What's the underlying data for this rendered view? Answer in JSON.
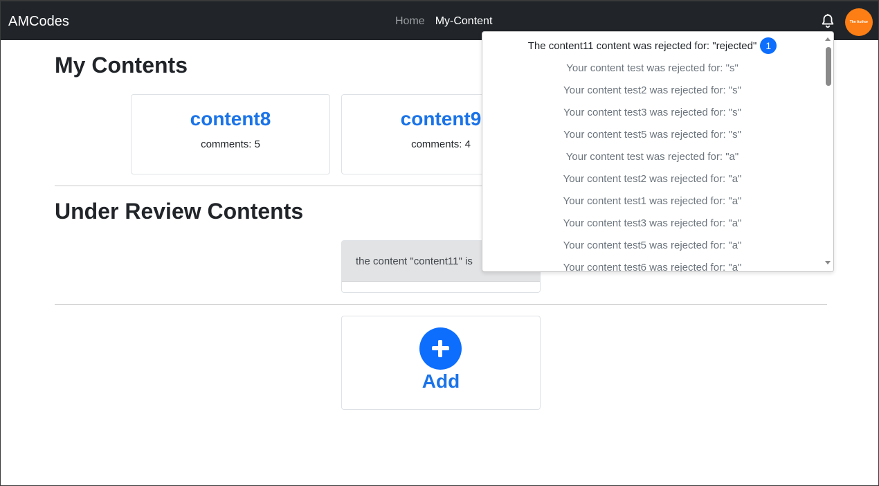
{
  "navbar": {
    "brand": "AMCodes",
    "links": [
      {
        "label": "Home"
      },
      {
        "label": "My-Content"
      }
    ],
    "avatar_text": "The Author",
    "icons": {
      "notifications": "bell-icon"
    }
  },
  "my_contents": {
    "title": "My Contents",
    "cards": [
      {
        "title": "content8",
        "comments": "comments: 5"
      },
      {
        "title": "content9",
        "comments": "comments: 4"
      }
    ]
  },
  "under_review": {
    "title": "Under Review Contents",
    "alert_text": "the content \"content11\" is"
  },
  "add_card": {
    "label": "Add",
    "icon": "plus-circle-icon"
  },
  "notifications": {
    "items": [
      {
        "text": "The content11 content was rejected for: \"rejected\"",
        "badge": "1"
      },
      {
        "text": "Your content test was rejected for: \"s\""
      },
      {
        "text": "Your content test2 was rejected for: \"s\""
      },
      {
        "text": "Your content test3 was rejected for: \"s\""
      },
      {
        "text": "Your content test5 was rejected for: \"s\""
      },
      {
        "text": "Your content test was rejected for: \"a\""
      },
      {
        "text": "Your content test2 was rejected for: \"a\""
      },
      {
        "text": "Your content test1 was rejected for: \"a\""
      },
      {
        "text": "Your content test3 was rejected for: \"a\""
      },
      {
        "text": "Your content test5 was rejected for: \"a\""
      },
      {
        "text": "Your content test6 was rejected for: \"a\""
      }
    ]
  },
  "colors": {
    "navbar": "#212529",
    "accent": "#0d6efd",
    "link_text": "#1a73e8",
    "avatar": "#fd7e14",
    "alert_bg": "#e2e3e5"
  }
}
